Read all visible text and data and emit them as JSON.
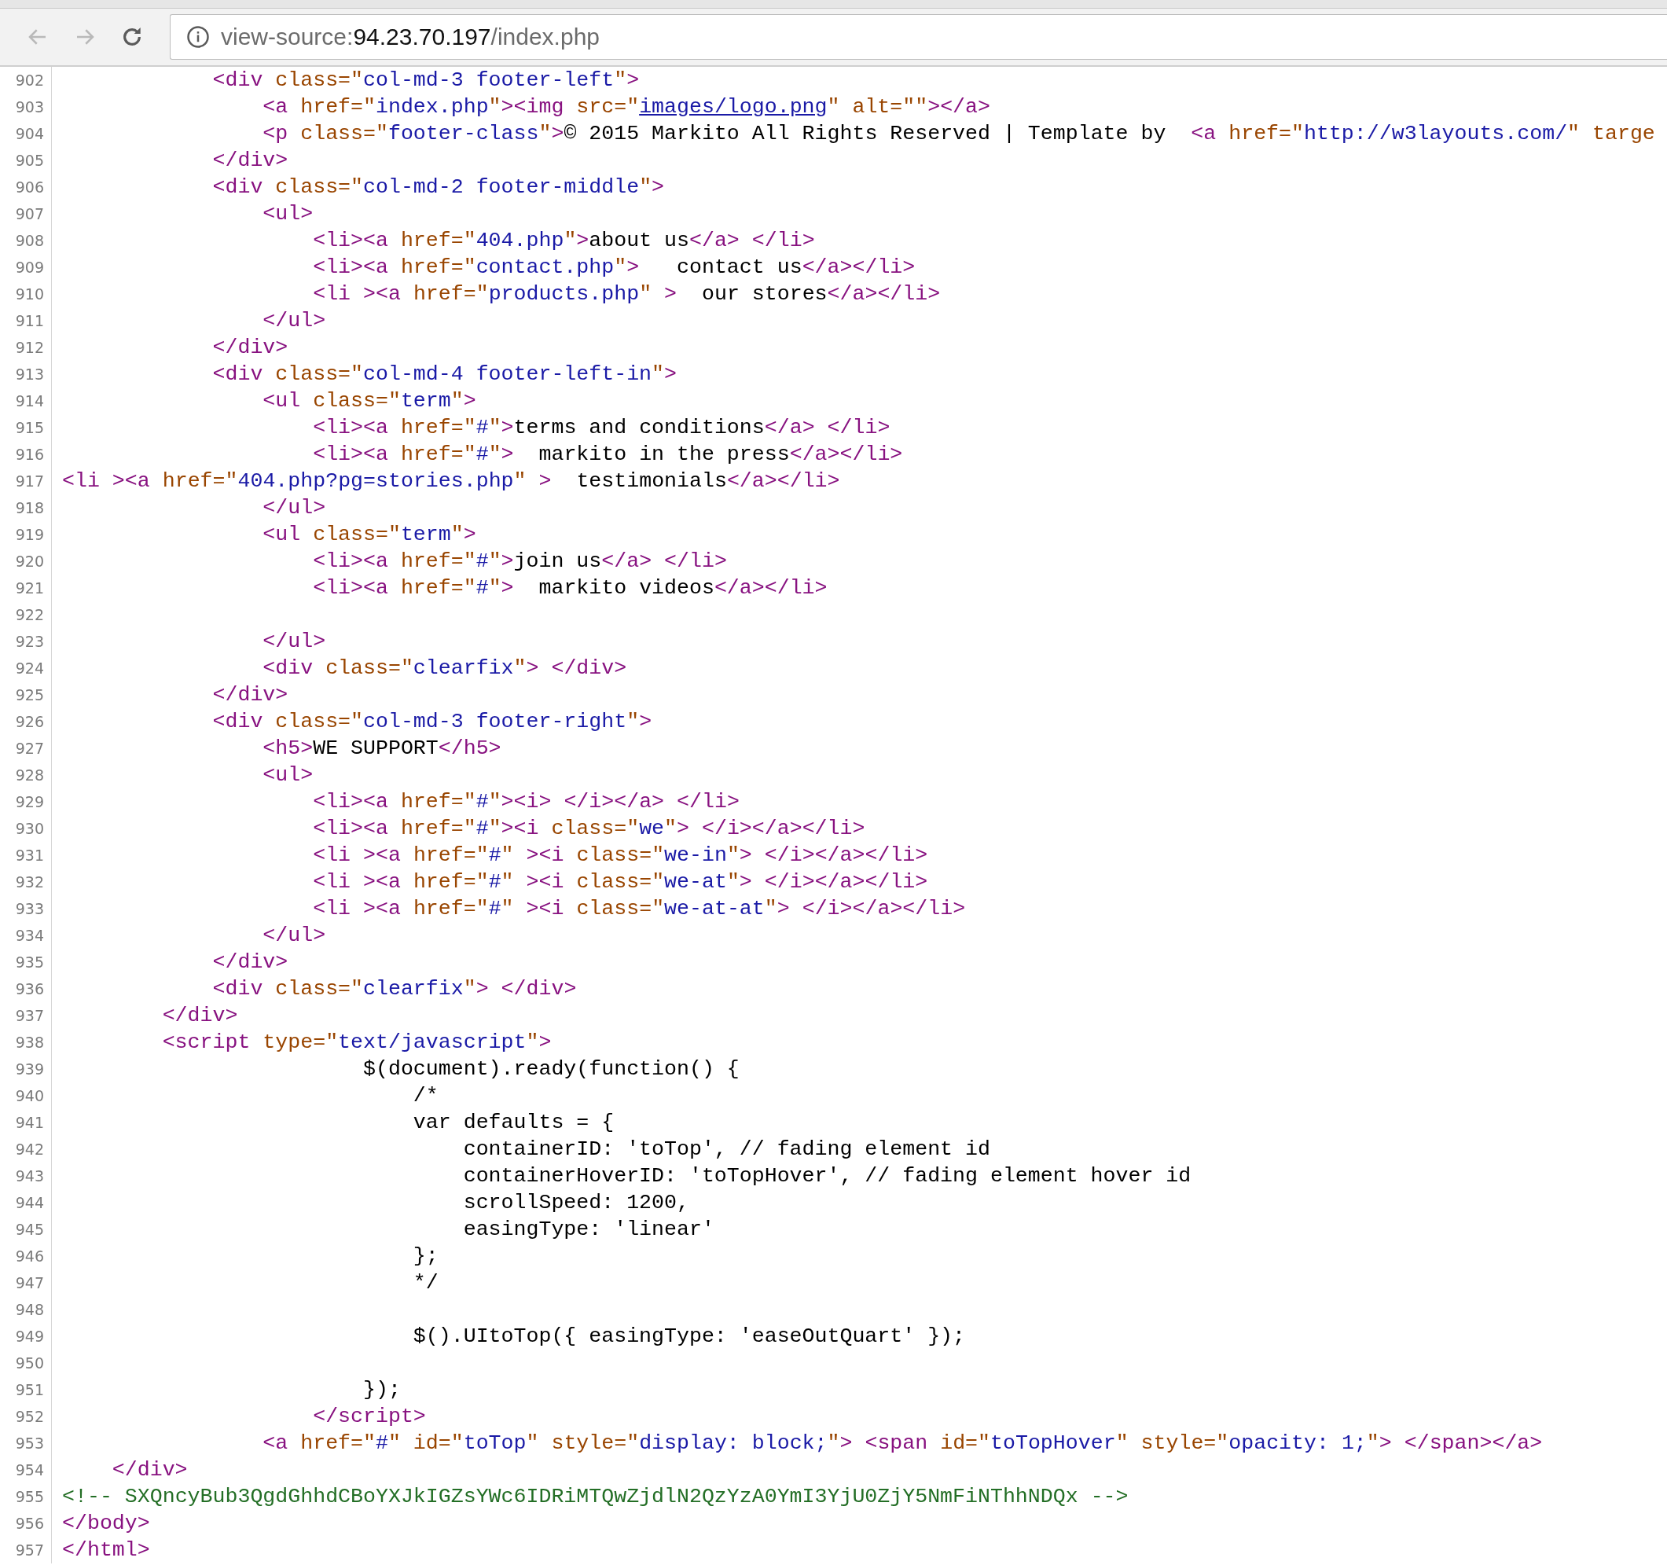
{
  "toolbar": {
    "back_button": {
      "disabled": true
    },
    "forward_button": {
      "disabled": true
    },
    "address": {
      "scheme": "view-source:",
      "host": "94.23.70.197",
      "path": "/index.php"
    }
  },
  "lines": [
    {
      "number": "902",
      "kind": "markup",
      "segments": [
        {
          "text": "            <div class=\"col-md-3 footer-left\">"
        }
      ]
    },
    {
      "number": "903",
      "kind": "markup",
      "segments": [
        {
          "text": "                <a href=\"index.php\"><img src=\""
        },
        {
          "text": "images/logo.png",
          "link": true
        },
        {
          "text": "\" alt=\"\"></a>"
        }
      ]
    },
    {
      "number": "904",
      "kind": "markup",
      "segments": [
        {
          "text": "                <p class=\"footer-class\">© 2015 Markito All Rights Reserved | Template by  <a href=\"http://w3layouts.com/\" targe"
        }
      ]
    },
    {
      "number": "905",
      "kind": "markup",
      "segments": [
        {
          "text": "            </div>"
        }
      ]
    },
    {
      "number": "906",
      "kind": "markup",
      "segments": [
        {
          "text": "            <div class=\"col-md-2 footer-middle\">"
        }
      ]
    },
    {
      "number": "907",
      "kind": "markup",
      "segments": [
        {
          "text": "                <ul>"
        }
      ]
    },
    {
      "number": "908",
      "kind": "markup",
      "segments": [
        {
          "text": "                    <li><a href=\"404.php\">about us</a> </li>"
        }
      ]
    },
    {
      "number": "909",
      "kind": "markup",
      "segments": [
        {
          "text": "                    <li><a href=\"contact.php\">   contact us</a></li>"
        }
      ]
    },
    {
      "number": "910",
      "kind": "markup",
      "segments": [
        {
          "text": "                    <li ><a href=\"products.php\" >  our stores</a></li>"
        }
      ]
    },
    {
      "number": "911",
      "kind": "markup",
      "segments": [
        {
          "text": "                </ul>"
        }
      ]
    },
    {
      "number": "912",
      "kind": "markup",
      "segments": [
        {
          "text": "            </div>"
        }
      ]
    },
    {
      "number": "913",
      "kind": "markup",
      "segments": [
        {
          "text": "            <div class=\"col-md-4 footer-left-in\">"
        }
      ]
    },
    {
      "number": "914",
      "kind": "markup",
      "segments": [
        {
          "text": "                <ul class=\"term\">"
        }
      ]
    },
    {
      "number": "915",
      "kind": "markup",
      "segments": [
        {
          "text": "                    <li><a href=\"#\">terms and conditions</a> </li>"
        }
      ]
    },
    {
      "number": "916",
      "kind": "markup",
      "segments": [
        {
          "text": "                    <li><a href=\"#\">  markito in the press</a></li>"
        }
      ]
    },
    {
      "number": "917",
      "kind": "markup",
      "segments": [
        {
          "text": "<li ><a href=\"404.php?pg=stories.php\" >  testimonials</a></li>"
        }
      ]
    },
    {
      "number": "918",
      "kind": "markup",
      "segments": [
        {
          "text": "                </ul>"
        }
      ]
    },
    {
      "number": "919",
      "kind": "markup",
      "segments": [
        {
          "text": "                <ul class=\"term\">"
        }
      ]
    },
    {
      "number": "920",
      "kind": "markup",
      "segments": [
        {
          "text": "                    <li><a href=\"#\">join us</a> </li>"
        }
      ]
    },
    {
      "number": "921",
      "kind": "markup",
      "segments": [
        {
          "text": "                    <li><a href=\"#\">  markito videos</a></li>"
        }
      ]
    },
    {
      "number": "922"
    },
    {
      "number": "923",
      "kind": "markup",
      "segments": [
        {
          "text": "                </ul>"
        }
      ]
    },
    {
      "number": "924",
      "kind": "markup",
      "segments": [
        {
          "text": "                <div class=\"clearfix\"> </div>"
        }
      ]
    },
    {
      "number": "925",
      "kind": "markup",
      "segments": [
        {
          "text": "            </div>"
        }
      ]
    },
    {
      "number": "926",
      "kind": "markup",
      "segments": [
        {
          "text": "            <div class=\"col-md-3 footer-right\">"
        }
      ]
    },
    {
      "number": "927",
      "kind": "markup",
      "segments": [
        {
          "text": "                <h5>WE SUPPORT</h5>"
        }
      ]
    },
    {
      "number": "928",
      "kind": "markup",
      "segments": [
        {
          "text": "                <ul>"
        }
      ]
    },
    {
      "number": "929",
      "kind": "markup",
      "segments": [
        {
          "text": "                    <li><a href=\"#\"><i> </i></a> </li>"
        }
      ]
    },
    {
      "number": "930",
      "kind": "markup",
      "segments": [
        {
          "text": "                    <li><a href=\"#\"><i class=\"we\"> </i></a></li>"
        }
      ]
    },
    {
      "number": "931",
      "kind": "markup",
      "segments": [
        {
          "text": "                    <li ><a href=\"#\" ><i class=\"we-in\"> </i></a></li>"
        }
      ]
    },
    {
      "number": "932",
      "kind": "markup",
      "segments": [
        {
          "text": "                    <li ><a href=\"#\" ><i class=\"we-at\"> </i></a></li>"
        }
      ]
    },
    {
      "number": "933",
      "kind": "markup",
      "segments": [
        {
          "text": "                    <li ><a href=\"#\" ><i class=\"we-at-at\"> </i></a></li>"
        }
      ]
    },
    {
      "number": "934",
      "kind": "markup",
      "segments": [
        {
          "text": "                </ul>"
        }
      ]
    },
    {
      "number": "935",
      "kind": "markup",
      "segments": [
        {
          "text": "            </div>"
        }
      ]
    },
    {
      "number": "936",
      "kind": "markup",
      "segments": [
        {
          "text": "            <div class=\"clearfix\"> </div>"
        }
      ]
    },
    {
      "number": "937",
      "kind": "markup",
      "segments": [
        {
          "text": "        </div>"
        }
      ]
    },
    {
      "number": "938",
      "kind": "markup",
      "segments": [
        {
          "text": "        <script type=\"text/javascript\">"
        }
      ]
    },
    {
      "number": "939",
      "kind": "script",
      "segments": [
        {
          "text": "                        $(document).ready(function() {"
        }
      ]
    },
    {
      "number": "940",
      "kind": "script",
      "segments": [
        {
          "text": "                            /*"
        }
      ]
    },
    {
      "number": "941",
      "kind": "script",
      "segments": [
        {
          "text": "                            var defaults = {"
        }
      ]
    },
    {
      "number": "942",
      "kind": "script",
      "segments": [
        {
          "text": "                                containerID: 'toTop', // fading element id"
        }
      ]
    },
    {
      "number": "943",
      "kind": "script",
      "segments": [
        {
          "text": "                                containerHoverID: 'toTopHover', // fading element hover id"
        }
      ]
    },
    {
      "number": "944",
      "kind": "script",
      "segments": [
        {
          "text": "                                scrollSpeed: 1200,"
        }
      ]
    },
    {
      "number": "945",
      "kind": "script",
      "segments": [
        {
          "text": "                                easingType: 'linear'"
        }
      ]
    },
    {
      "number": "946",
      "kind": "script",
      "segments": [
        {
          "text": "                            };"
        }
      ]
    },
    {
      "number": "947",
      "kind": "script",
      "segments": [
        {
          "text": "                            */"
        }
      ]
    },
    {
      "number": "948"
    },
    {
      "number": "949",
      "kind": "script",
      "segments": [
        {
          "text": "                            $().UItoTop({ easingType: 'easeOutQuart' });"
        }
      ]
    },
    {
      "number": "950"
    },
    {
      "number": "951",
      "kind": "script",
      "segments": [
        {
          "text": "                        });"
        }
      ]
    },
    {
      "number": "952",
      "kind": "markup",
      "segments": [
        {
          "text": "                    </script>"
        }
      ]
    },
    {
      "number": "953",
      "kind": "markup",
      "segments": [
        {
          "text": "                <a href=\"#\" id=\"toTop\" style=\"display: block;\"> <span id=\"toTopHover\" style=\"opacity: 1;\"> </span></a>"
        }
      ]
    },
    {
      "number": "954",
      "kind": "markup",
      "segments": [
        {
          "text": "    </div>"
        }
      ]
    },
    {
      "number": "955",
      "kind": "comment",
      "segments": [
        {
          "text": "<!-- SXQncyBub3QgdGhhdCBoYXJkIGZsYWc6IDRiMTQwZjdlN2QzYzA0YmI3YjU0ZjY5NmFiNThhNDQx -->"
        }
      ]
    },
    {
      "number": "956",
      "kind": "markup",
      "segments": [
        {
          "text": "</body>"
        }
      ]
    },
    {
      "number": "957",
      "kind": "markup",
      "segments": [
        {
          "text": "</html>"
        }
      ]
    }
  ]
}
